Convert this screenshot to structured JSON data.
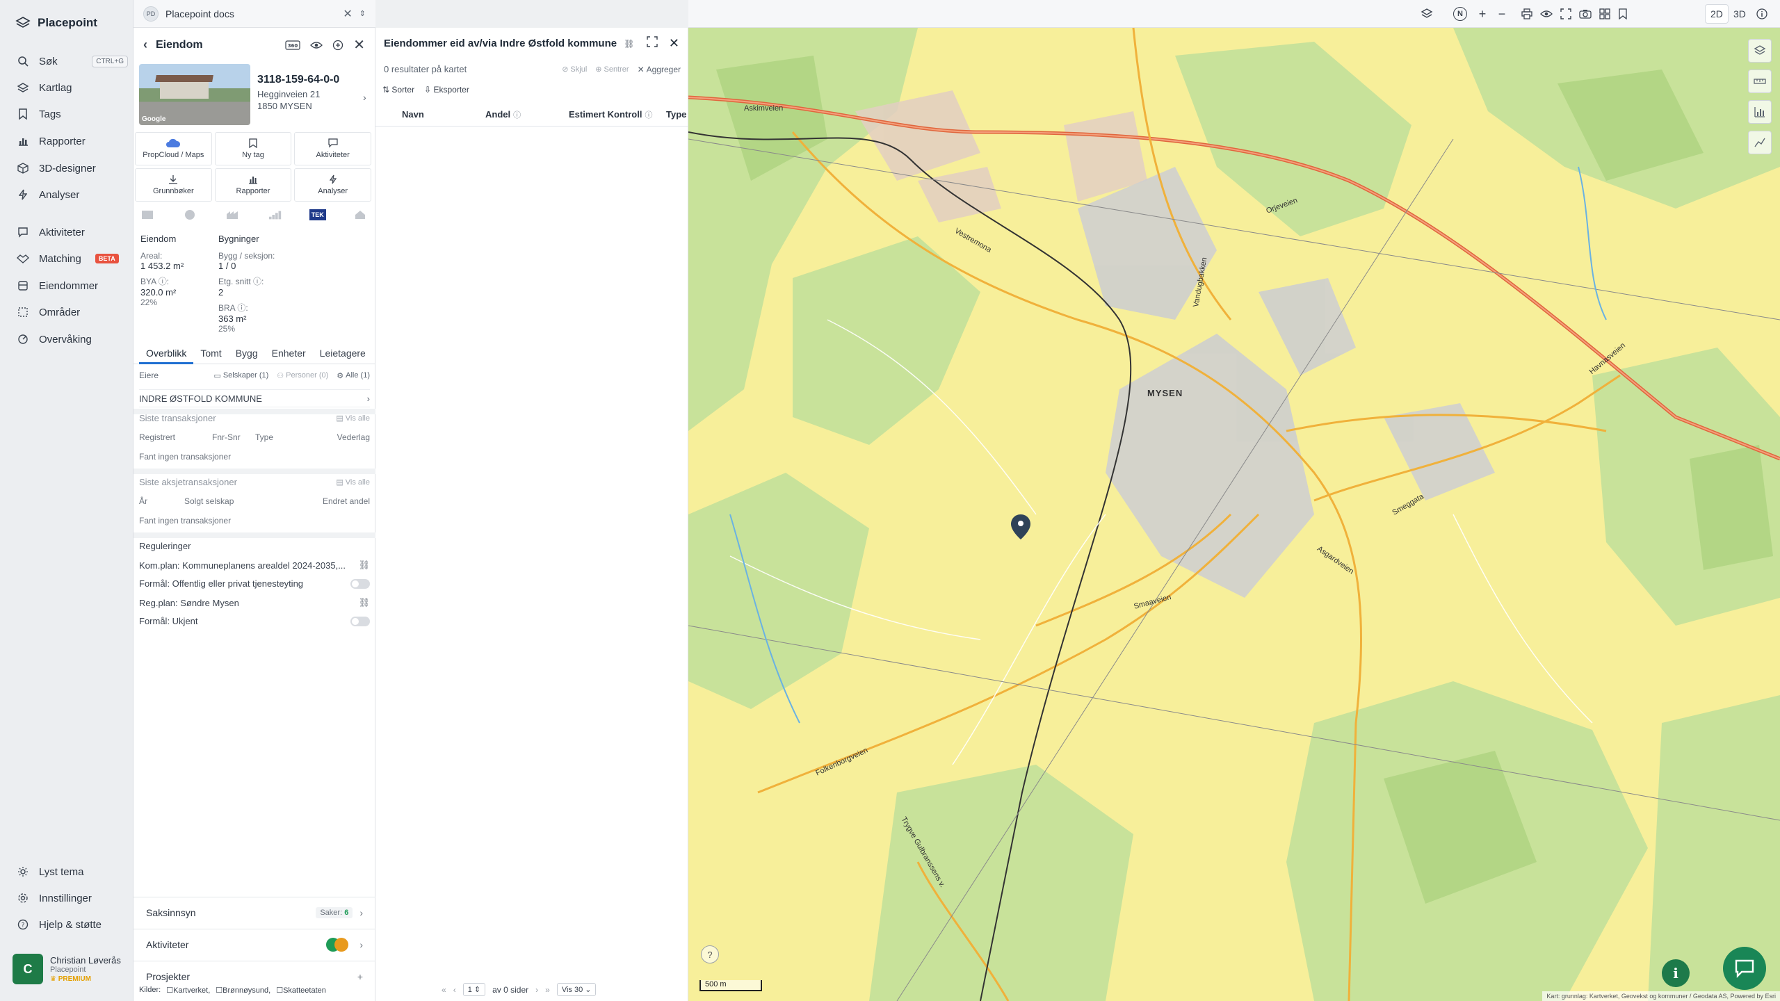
{
  "app": {
    "name": "Placepoint",
    "doc_badge": "PD",
    "doc_title": "Placepoint docs"
  },
  "nav": {
    "items": [
      {
        "label": "Søk",
        "shortcut": "CTRL+G",
        "icon": "search-icon"
      },
      {
        "label": "Kartlag",
        "icon": "layers-icon"
      },
      {
        "label": "Tags",
        "icon": "bookmark-icon"
      },
      {
        "label": "Rapporter",
        "icon": "bar-chart-icon"
      },
      {
        "label": "3D-designer",
        "icon": "cube-icon"
      },
      {
        "label": "Analyser",
        "icon": "bolt-icon"
      },
      {
        "label": "Aktiviteter",
        "icon": "chat-icon"
      },
      {
        "label": "Matching",
        "badge": "BETA",
        "icon": "handshake-icon"
      },
      {
        "label": "Eiendommer",
        "icon": "building-icon"
      },
      {
        "label": "Områder",
        "icon": "area-icon"
      },
      {
        "label": "Overvåking",
        "icon": "monitor-icon"
      }
    ],
    "bottom": [
      {
        "label": "Lyst tema",
        "icon": "sun-icon"
      },
      {
        "label": "Innstillinger",
        "icon": "gear-icon"
      },
      {
        "label": "Hjelp & støtte",
        "icon": "help-icon"
      }
    ],
    "user": {
      "initial": "C",
      "name": "Christian Løverås",
      "org": "Placepoint",
      "plan": "PREMIUM"
    }
  },
  "property": {
    "title": "Eiendom",
    "photo_credit": "Google",
    "id": "3118-159-64-0-0",
    "street": "Hegginveien 21",
    "postal": "1850 MYSEN",
    "actions": [
      "PropCloud / Maps",
      "Ny tag",
      "Aktiviteter",
      "Grunnbøker",
      "Rapporter",
      "Analyser"
    ],
    "tek_label": "TEK",
    "facts": {
      "left_header": "Eiendom",
      "right_header": "Bygninger",
      "areal_label": "Areal:",
      "areal_value": "1 453.2 m²",
      "bya_label": "BYA ⓘ:",
      "bya_value": "320.0 m²",
      "bya_pct": "22%",
      "bygg_label": "Bygg / seksjon:",
      "bygg_value": "1 / 0",
      "etg_label": "Etg. snitt ⓘ:",
      "etg_value": "2",
      "bra_label": "BRA ⓘ:",
      "bra_value": "363 m²",
      "bra_pct": "25%"
    },
    "tabs": [
      "Overblikk",
      "Tomt",
      "Bygg",
      "Enheter",
      "Leietagere"
    ],
    "owners": {
      "label": "Eiere",
      "companies": "Selskaper (1)",
      "persons": "Personer (0)",
      "all": "Alle (1)",
      "owner_name": "INDRE ØSTFOLD KOMMUNE"
    },
    "transactions": {
      "title": "Siste transaksjoner",
      "show_all": "Vis alle",
      "cols": [
        "Registrert",
        "Fnr-Snr",
        "Type",
        "Vederlag"
      ],
      "empty": "Fant ingen transaksjoner"
    },
    "share_transactions": {
      "title": "Siste aksjetransaksjoner",
      "show_all": "Vis alle",
      "cols": [
        "År",
        "Solgt selskap",
        "Endret andel"
      ],
      "empty": "Fant ingen transaksjoner"
    },
    "regulations": {
      "title": "Reguleringer",
      "rows": [
        "Kom.plan: Kommuneplanens arealdel 2024-2035,...",
        "Formål: Offentlig eller privat tjenesteyting",
        "Reg.plan: Søndre Mysen",
        "Formål: Ukjent"
      ]
    },
    "accordions": {
      "saksinnsyn": "Saksinnsyn",
      "saker_label": "Saker:",
      "saker_count": "6",
      "aktiviteter": "Aktiviteter",
      "prosjekter": "Prosjekter"
    },
    "sources": {
      "label": "Kilder:",
      "items": [
        "Kartverket,",
        "Brønnøysund,",
        "Skatteetaten"
      ]
    }
  },
  "results": {
    "title": "Eiendommer eid av/via Indre Østfold kommune",
    "count_text": "0 resultater på kartet",
    "actions": [
      "Skjul",
      "Sentrer",
      "Aggreger"
    ],
    "tools": [
      "Sorter",
      "Eksporter"
    ],
    "columns": [
      "Navn",
      "Andel",
      "Estimert Kontroll",
      "Type"
    ],
    "pager": {
      "page": "1",
      "of_text": "av 0 sider",
      "per_page": "Vis 30"
    }
  },
  "map": {
    "toolbar": {
      "north": "N",
      "dim2d": "2D",
      "dim3d": "3D"
    },
    "scale": "500 m",
    "attribution": "Kart: grunnlag: Kartverket, Geovekst og kommuner / Geodata AS, Powered by Esri",
    "labels": [
      "MYSEN",
      "Askimveien",
      "Vestremona",
      "Orjeveien",
      "Smaaveien",
      "Folkenborgveien",
      "Trygve Gulbranssens v.",
      "Havnasveien",
      "Asgardveien",
      "Smeggata",
      "Vandugbakken"
    ]
  }
}
